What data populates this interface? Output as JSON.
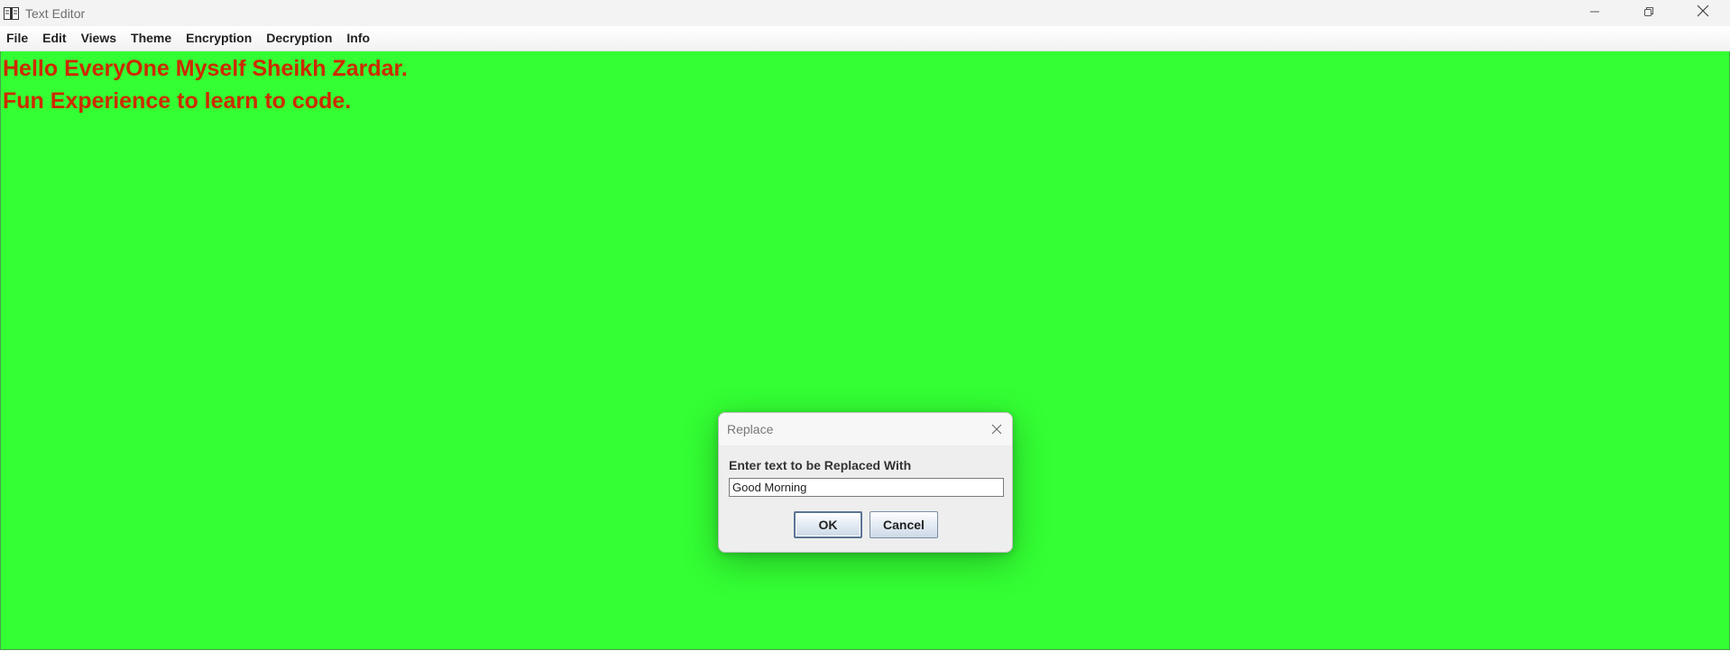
{
  "window": {
    "title": "Text Editor"
  },
  "menu": {
    "items": [
      "File",
      "Edit",
      "Views",
      "Theme",
      "Encryption",
      "Decryption",
      "Info"
    ]
  },
  "editor": {
    "lines": [
      "Hello EveryOne Myself Sheikh Zardar.",
      "Fun Experience to learn to code."
    ],
    "background_color": "#33ff33",
    "text_color": "#cc2b00"
  },
  "dialog": {
    "title": "Replace",
    "label": "Enter text to be Replaced With",
    "input_value": "Good Morning",
    "ok_label": "OK",
    "cancel_label": "Cancel"
  },
  "icons": {
    "app": "notebook-icon",
    "minimize": "minimize-icon",
    "restore": "restore-icon",
    "close": "close-icon",
    "dialog_close": "close-icon"
  }
}
